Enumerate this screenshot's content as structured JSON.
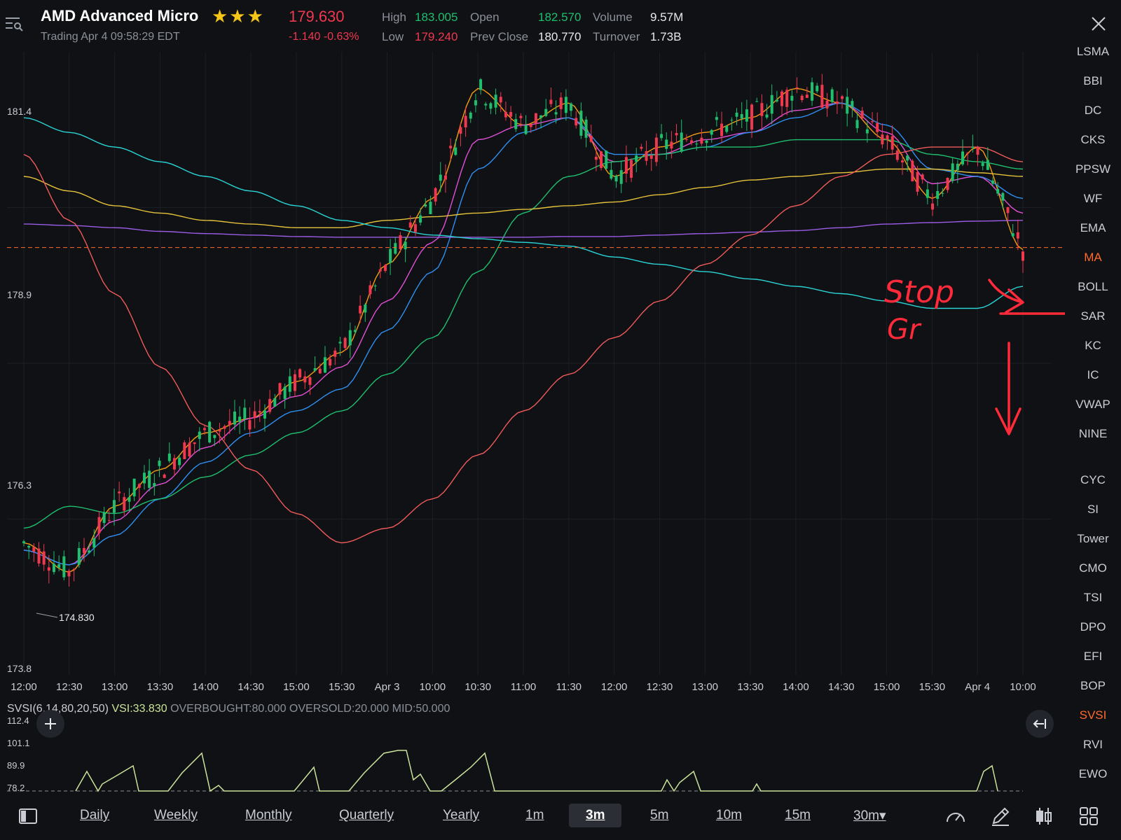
{
  "header": {
    "symbol_name": "AMD  Advanced Micro",
    "stars": "★★★",
    "status": "Trading Apr 4 09:58:29 EDT",
    "price": "179.630",
    "change": "-1.140 -0.63%",
    "stats": {
      "high_label": "High",
      "high": "183.005",
      "low_label": "Low",
      "low": "179.240",
      "open_label": "Open",
      "open": "182.570",
      "prev_close_label": "Prev Close",
      "prev_close": "180.770",
      "volume_label": "Volume",
      "volume": "9.57M",
      "turnover_label": "Turnover",
      "turnover": "1.73B"
    }
  },
  "chart": {
    "y_ticks": [
      "181.4",
      "178.9",
      "176.3",
      "173.8"
    ],
    "low_marker": "174.830",
    "x_ticks": [
      "12:00",
      "12:30",
      "13:00",
      "13:30",
      "14:00",
      "14:30",
      "15:00",
      "15:30",
      "Apr 3",
      "10:00",
      "10:30",
      "11:00",
      "11:30",
      "12:00",
      "12:30",
      "13:00",
      "13:30",
      "14:00",
      "14:30",
      "15:00",
      "15:30",
      "Apr 4",
      "10:00"
    ],
    "annotation": {
      "line1": "Stop",
      "line2": "Gr"
    }
  },
  "chart_data": {
    "type": "line",
    "ylim": [
      173.8,
      182.3
    ],
    "x": [
      "12:00",
      "12:30",
      "13:00",
      "13:30",
      "14:00",
      "14:30",
      "15:00",
      "15:30",
      "Apr 3",
      "10:00",
      "10:30",
      "11:00",
      "11:30",
      "12:00",
      "12:30",
      "13:00",
      "13:30",
      "14:00",
      "14:30",
      "15:00",
      "15:30",
      "Apr 4",
      "10:00"
    ],
    "series": [
      {
        "values": [
          175.6,
          175.2,
          176.1,
          176.6,
          177.1,
          177.3,
          177.8,
          178.2,
          179.4,
          180.3,
          181.8,
          181.3,
          181.6,
          180.6,
          181.0,
          181.2,
          181.4,
          181.8,
          181.6,
          181.1,
          180.3,
          181.0,
          179.6
        ],
        "color": "#f39c12"
      },
      {
        "values": [
          175.5,
          175.3,
          175.9,
          176.4,
          176.9,
          177.3,
          177.6,
          178.0,
          178.9,
          179.7,
          181.1,
          181.3,
          181.4,
          180.8,
          180.9,
          181.1,
          181.2,
          181.5,
          181.6,
          181.2,
          180.5,
          180.6,
          180.1
        ],
        "color": "#e34fd6"
      },
      {
        "values": [
          175.5,
          175.3,
          175.7,
          176.2,
          176.7,
          177.1,
          177.4,
          177.7,
          178.5,
          179.3,
          180.7,
          181.2,
          181.4,
          180.9,
          180.9,
          181.0,
          181.2,
          181.4,
          181.6,
          181.3,
          180.7,
          180.6,
          180.3
        ],
        "color": "#2f8ff0"
      },
      {
        "values": [
          175.8,
          176.1,
          176.0,
          176.2,
          176.5,
          176.8,
          177.1,
          177.4,
          177.9,
          178.4,
          179.3,
          180.1,
          180.6,
          180.8,
          180.9,
          181.0,
          181.0,
          181.1,
          181.1,
          181.1,
          180.9,
          180.8,
          180.7
        ],
        "color": "#1fbf6e"
      },
      {
        "values": [
          180.6,
          180.4,
          180.2,
          180.1,
          180.0,
          179.95,
          179.9,
          179.9,
          180.0,
          180.05,
          180.1,
          180.15,
          180.2,
          180.25,
          180.35,
          180.45,
          180.55,
          180.6,
          180.65,
          180.7,
          180.7,
          180.65,
          180.6
        ],
        "color": "#e6c23a"
      },
      {
        "values": [
          179.95,
          179.93,
          179.9,
          179.85,
          179.82,
          179.8,
          179.78,
          179.77,
          179.77,
          179.77,
          179.77,
          179.77,
          179.78,
          179.78,
          179.8,
          179.82,
          179.84,
          179.86,
          179.9,
          179.95,
          179.97,
          179.99,
          180.0
        ],
        "color": "#9b5de5"
      },
      {
        "values": [
          181.4,
          181.2,
          181.0,
          180.8,
          180.6,
          180.4,
          180.2,
          180.0,
          179.9,
          179.8,
          179.75,
          179.7,
          179.65,
          179.5,
          179.4,
          179.3,
          179.2,
          179.1,
          179.0,
          178.9,
          178.8,
          178.8,
          179.1
        ],
        "color": "#2ad4d4"
      },
      {
        "values": [
          180.9,
          180.0,
          179.0,
          178.0,
          177.2,
          176.6,
          176.0,
          175.6,
          175.8,
          176.2,
          176.8,
          177.4,
          177.9,
          178.4,
          178.9,
          179.4,
          179.8,
          180.2,
          180.6,
          180.9,
          181.0,
          181.0,
          180.8
        ],
        "color": "#f05a5a"
      }
    ],
    "reference_line": 179.63
  },
  "svsi": {
    "title": "SVSI(6,14,80,20,50)",
    "vsi": "VSI:33.830",
    "params": "OVERBOUGHT:80.000  OVERSOLD:20.000  MID:50.000",
    "y_ticks": [
      "112.4",
      "101.1",
      "89.9",
      "78.2"
    ]
  },
  "indicators": [
    "LSMA",
    "BBI",
    "DC",
    "CKS",
    "PPSW",
    "WF",
    "EMA",
    "MA",
    "BOLL",
    "SAR",
    "KC",
    "IC",
    "VWAP",
    "NINE",
    "CYC",
    "SI",
    "Tower",
    "CMO",
    "TSI",
    "DPO",
    "EFI",
    "BOP",
    "SVSI",
    "RVI",
    "EWO"
  ],
  "active_indicators": [
    "MA",
    "SVSI"
  ],
  "periods": [
    "Daily",
    "Weekly",
    "Monthly",
    "Quarterly",
    "Yearly",
    "1m",
    "3m",
    "5m",
    "10m",
    "15m",
    "30m▾"
  ],
  "active_period": "3m",
  "colors": {
    "up": "#1fbf6e",
    "down": "#f0384f",
    "accent": "#ff6a2a",
    "annotation": "#ff2a3a"
  }
}
